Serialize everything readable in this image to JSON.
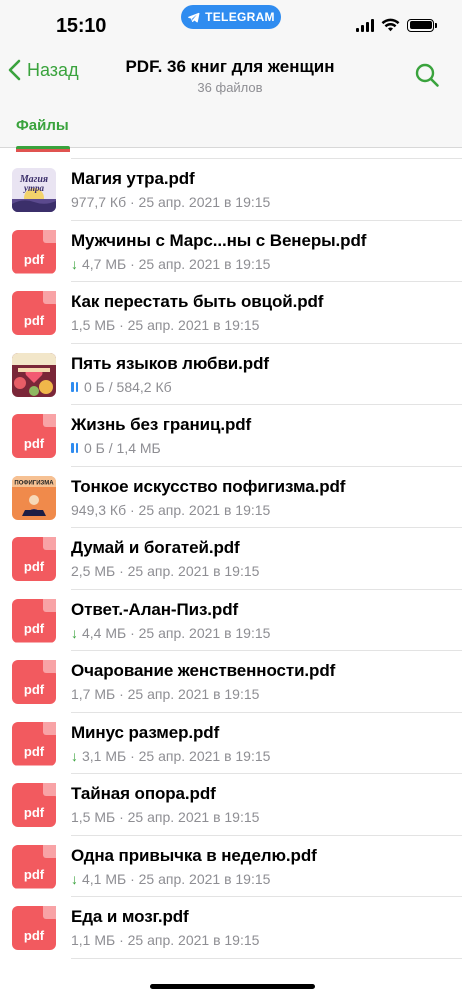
{
  "status": {
    "time": "15:10",
    "telegram_pill": "TELEGRAM"
  },
  "nav": {
    "back_label": "Назад",
    "title": "PDF. 36 книг для женщин",
    "subtitle": "36 файлов"
  },
  "tabs": {
    "files_label": "Файлы"
  },
  "colors": {
    "accent": "#3aa33d",
    "pdf_red": "#f25a5f",
    "telegram_blue": "#2f8cf0"
  },
  "files": [
    {
      "name": "Магия утра.pdf",
      "meta": "977,7 Кб · 25 апр. 2021 в 19:15",
      "status": "done",
      "icon": "cover-magiya-utra"
    },
    {
      "name": "Мужчины с Марс...ны с Венеры.pdf",
      "meta": "4,7 МБ · 25 апр. 2021 в 19:15",
      "status": "downloaded",
      "icon": "pdf"
    },
    {
      "name": "Как перестать быть овцой.pdf",
      "meta": "1,5 МБ · 25 апр. 2021 в 19:15",
      "status": "done",
      "icon": "pdf"
    },
    {
      "name": "Пять языков любви.pdf",
      "meta": "0 Б / 584,2 Кб",
      "status": "paused",
      "icon": "cover-pyat-yazykov"
    },
    {
      "name": "Жизнь без границ.pdf",
      "meta": "0 Б / 1,4 МБ",
      "status": "paused",
      "icon": "pdf"
    },
    {
      "name": "Тонкое искусство пофигизма.pdf",
      "meta": "949,3 Кб · 25 апр. 2021 в 19:15",
      "status": "done",
      "icon": "cover-pofigizm"
    },
    {
      "name": "Думай и богатей.pdf",
      "meta": "2,5 МБ · 25 апр. 2021 в 19:15",
      "status": "done",
      "icon": "pdf"
    },
    {
      "name": "Ответ.-Алан-Пиз.pdf",
      "meta": "4,4 МБ · 25 апр. 2021 в 19:15",
      "status": "downloaded",
      "icon": "pdf"
    },
    {
      "name": "Очарование женственности.pdf",
      "meta": "1,7 МБ · 25 апр. 2021 в 19:15",
      "status": "done",
      "icon": "pdf"
    },
    {
      "name": "Минус размер.pdf",
      "meta": "3,1 МБ · 25 апр. 2021 в 19:15",
      "status": "downloaded",
      "icon": "pdf"
    },
    {
      "name": "Тайная опора.pdf",
      "meta": "1,5 МБ · 25 апр. 2021 в 19:15",
      "status": "done",
      "icon": "pdf"
    },
    {
      "name": "Одна привычка в неделю.pdf",
      "meta": "4,1 МБ · 25 апр. 2021 в 19:15",
      "status": "downloaded",
      "icon": "pdf"
    },
    {
      "name": "Еда и мозг.pdf",
      "meta": "1,1 МБ · 25 апр. 2021 в 19:15",
      "status": "done",
      "icon": "pdf"
    }
  ],
  "pdf_icon_label": "pdf",
  "cover_texts": {
    "magiya_utra": "Магия утра",
    "pofigizm": "ПОФИГИЗМА"
  }
}
